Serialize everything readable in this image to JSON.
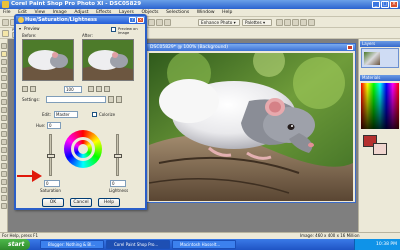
{
  "window": {
    "title": "Corel Paint Shop Pro Photo XI - DSC05829"
  },
  "menu": [
    "File",
    "Edit",
    "View",
    "Image",
    "Adjust",
    "Effects",
    "Layers",
    "Objects",
    "Selections",
    "Window",
    "Help"
  ],
  "toolbar": {
    "enhance_photo": "Enhance Photo",
    "palettes": "Palettes",
    "zoom_label": "Zoom (%):",
    "zoom_value": "100",
    "zoom_more_less": "Zoom more/less",
    "zoom_to": "Zoom to",
    "presets_label": "Presets:",
    "zoom_to_button": "1:1"
  },
  "image_window": {
    "title": "DSC05829* @ 100% (Background)"
  },
  "dialog": {
    "title": "Hue/Saturation/Lightness",
    "preview_label": "Preview",
    "before_label": "Before:",
    "after_label": "After:",
    "preview_on_image": "Preview on Image",
    "zoom_value": "100",
    "settings_label": "Settings:",
    "edit_label": "Edit:",
    "edit_value": "Master",
    "colorize_label": "Colorize",
    "hue_label": "Hue:",
    "hue_value": "0",
    "saturation_label": "Saturation",
    "saturation_value": "0",
    "lightness_label": "Lightness",
    "lightness_value": "0",
    "ok": "OK",
    "cancel": "Cancel",
    "help": "Help"
  },
  "palettes": {
    "layers_title": "Layers",
    "materials_title": "Materials"
  },
  "status": {
    "left": "For Help, press F1",
    "right": "Image: 460 x 400 x 16 Million"
  },
  "taskbar": {
    "start": "start",
    "tasks": [
      "Blogger: Nothing & Bl...",
      "Corel Paint Shop Pro...",
      "Macintosh Hasselt..."
    ],
    "clock": "10:38 PM"
  },
  "colors": {
    "accent": "#2a63cf",
    "arrow": "#e0180a",
    "workspace": "#7f7f7f"
  }
}
